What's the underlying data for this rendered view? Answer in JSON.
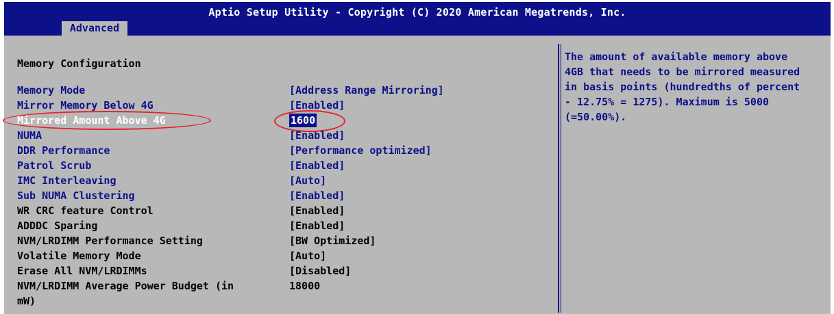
{
  "header": {
    "title": "Aptio Setup Utility - Copyright (C) 2020 American Megatrends, Inc.",
    "active_tab": "Advanced"
  },
  "section_title": "Memory Configuration",
  "items": [
    {
      "label": "Memory Mode",
      "value": "[Address Range Mirroring]",
      "style": "blue"
    },
    {
      "label": "Mirror Memory Below 4G",
      "value": "[Enabled]",
      "style": "blue"
    },
    {
      "label": "Mirrored Amount Above 4G",
      "value": "1600",
      "style": "selected"
    },
    {
      "label": "NUMA",
      "value": "[Enabled]",
      "style": "blue"
    },
    {
      "label": "DDR Performance",
      "value": "[Performance optimized]",
      "style": "blue"
    },
    {
      "label": "Patrol Scrub",
      "value": "[Enabled]",
      "style": "blue"
    },
    {
      "label": "IMC Interleaving",
      "value": "[Auto]",
      "style": "blue"
    },
    {
      "label": "Sub NUMA Clustering",
      "value": "[Enabled]",
      "style": "blue"
    },
    {
      "label": "WR CRC feature Control",
      "value": "[Enabled]",
      "style": "black"
    },
    {
      "label": "ADDDC Sparing",
      "value": "[Enabled]",
      "style": "black"
    },
    {
      "label": "NVM/LRDIMM Performance Setting",
      "value": "[BW Optimized]",
      "style": "black"
    },
    {
      "label": "Volatile Memory Mode",
      "value": "[Auto]",
      "style": "black"
    },
    {
      "label": "Erase All NVM/LRDIMMs",
      "value": "[Disabled]",
      "style": "black"
    },
    {
      "label": "NVM/LRDIMM Average Power Budget (in",
      "value": "18000",
      "style": "black"
    },
    {
      "label": "mW)",
      "value": "",
      "style": "black"
    }
  ],
  "help": {
    "text": "The amount of available memory above\n4GB that needs to be mirrored measured\nin basis points (hundredths of percent\n- 12.75% = 1275). Maximum is 5000\n(=50.00%)."
  },
  "colors": {
    "header_bg": "#0c1089",
    "panel_bg": "#b8b8b8",
    "link_blue": "#0c1089",
    "annotation_red": "#e4232a"
  }
}
